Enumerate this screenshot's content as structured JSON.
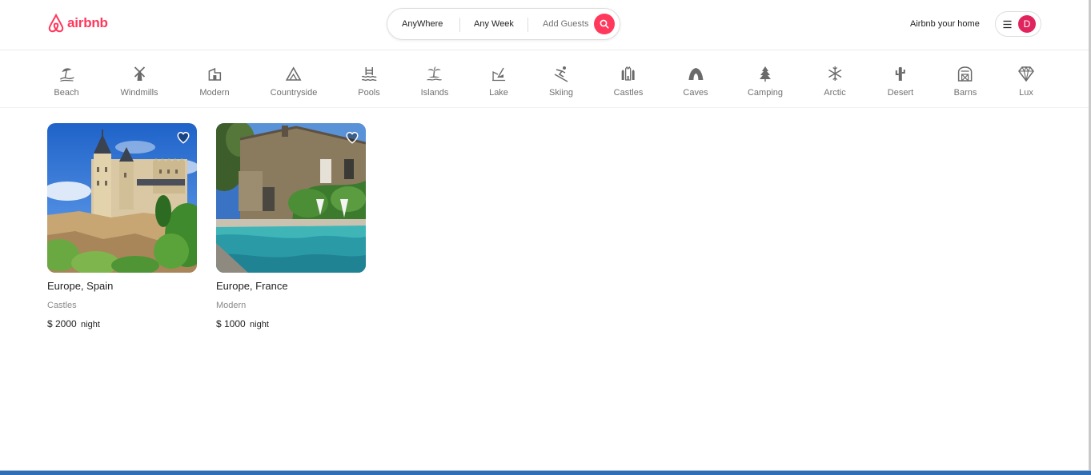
{
  "header": {
    "logo_text": "airbnb",
    "search": {
      "where": "AnyWhere",
      "when": "Any Week",
      "who": "Add Guests"
    },
    "host_link": "Airbnb your home",
    "avatar_letter": "D"
  },
  "categories": [
    {
      "label": "Beach",
      "icon": "beach-icon"
    },
    {
      "label": "Windmills",
      "icon": "windmill-icon"
    },
    {
      "label": "Modern",
      "icon": "modern-house-icon"
    },
    {
      "label": "Countryside",
      "icon": "mountain-icon"
    },
    {
      "label": "Pools",
      "icon": "pool-icon"
    },
    {
      "label": "Islands",
      "icon": "island-icon"
    },
    {
      "label": "Lake",
      "icon": "lake-icon"
    },
    {
      "label": "Skiing",
      "icon": "skiing-icon"
    },
    {
      "label": "Castles",
      "icon": "castle-icon"
    },
    {
      "label": "Caves",
      "icon": "cave-icon"
    },
    {
      "label": "Camping",
      "icon": "camping-icon"
    },
    {
      "label": "Arctic",
      "icon": "snowflake-icon"
    },
    {
      "label": "Desert",
      "icon": "cactus-icon"
    },
    {
      "label": "Barns",
      "icon": "barn-icon"
    },
    {
      "label": "Lux",
      "icon": "diamond-icon"
    }
  ],
  "listings": [
    {
      "location": "Europe, Spain",
      "category": "Castles",
      "price": "$ 2000",
      "unit": "night"
    },
    {
      "location": "Europe, France",
      "category": "Modern",
      "price": "$ 1000",
      "unit": "night"
    }
  ],
  "colors": {
    "brand": "#ff385c",
    "avatar": "#e0245e",
    "muted_text": "#717171"
  }
}
